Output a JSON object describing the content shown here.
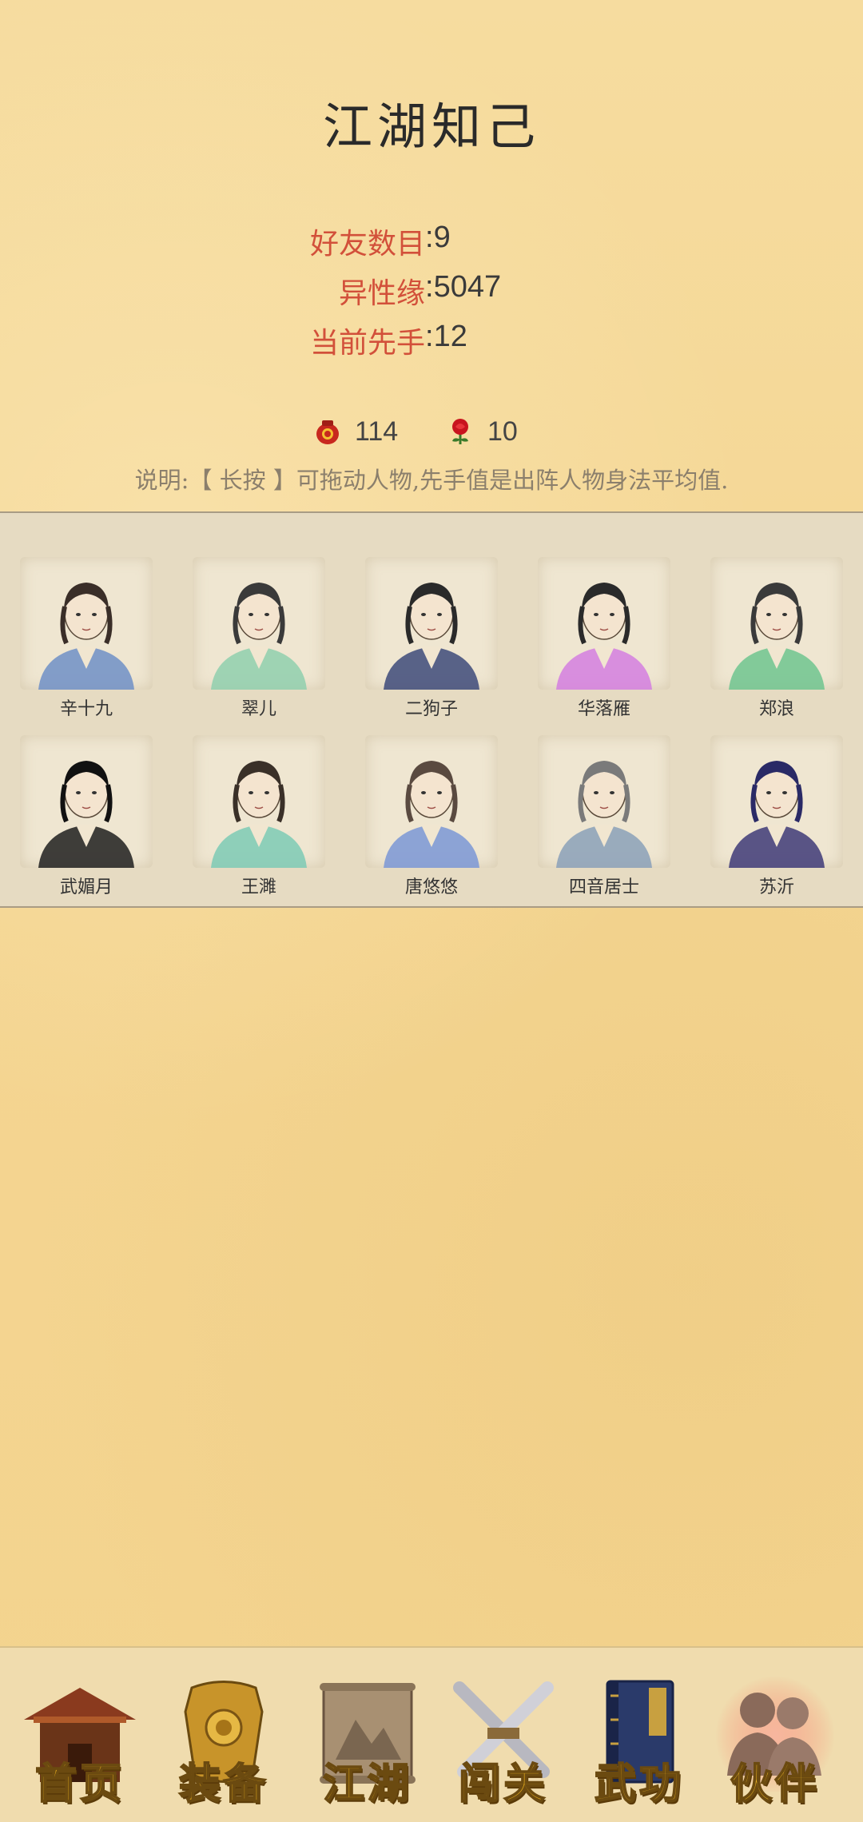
{
  "page": {
    "title": "江湖知己"
  },
  "stats": [
    {
      "label": "好友数目",
      "value": "9"
    },
    {
      "label": "异性缘",
      "value": "5047"
    },
    {
      "label": "当前先手",
      "value": "12"
    }
  ],
  "separator": ":",
  "currency": {
    "wine": {
      "icon": "wine-jar-icon",
      "value": "114"
    },
    "rose": {
      "icon": "rose-icon",
      "value": "10"
    }
  },
  "hint": "说明:【 长按 】可拖动人物,先手值是出阵人物身法平均值.",
  "characters": [
    {
      "name": "辛十九",
      "robe": "#6f8fc7",
      "hair": "#3a2e28"
    },
    {
      "name": "翠儿",
      "robe": "#8fcfae",
      "hair": "#3a3a3a"
    },
    {
      "name": "二狗子",
      "robe": "#3d4a7a",
      "hair": "#2a2a2a"
    },
    {
      "name": "华落雁",
      "robe": "#d47ee0",
      "hair": "#2a2a2a"
    },
    {
      "name": "郑浪",
      "robe": "#6fc48f",
      "hair": "#3a3a3a"
    },
    {
      "name": "武媚月",
      "robe": "#1e1e1e",
      "hair": "#111111"
    },
    {
      "name": "王濉",
      "robe": "#7ccab5",
      "hair": "#3a3028"
    },
    {
      "name": "唐悠悠",
      "robe": "#7a96d6",
      "hair": "#5a4a40"
    },
    {
      "name": "四音居士",
      "robe": "#8aa0b8",
      "hair": "#7a7a7a"
    },
    {
      "name": "苏沂",
      "robe": "#3e3a78",
      "hair": "#2a2a66"
    }
  ],
  "nav": [
    {
      "label": "首页",
      "icon": "house-icon",
      "active": false
    },
    {
      "label": "装备",
      "icon": "armor-icon",
      "active": false
    },
    {
      "label": "江湖",
      "icon": "scroll-map-icon",
      "active": false
    },
    {
      "label": "闯关",
      "icon": "crossed-swords-icon",
      "active": false
    },
    {
      "label": "武功",
      "icon": "book-icon",
      "active": false
    },
    {
      "label": "伙伴",
      "icon": "companions-icon",
      "active": true
    }
  ]
}
